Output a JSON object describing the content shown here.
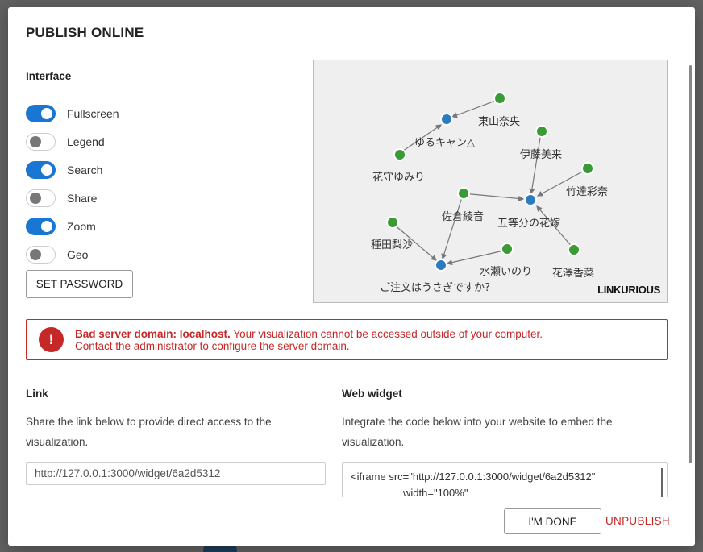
{
  "dialog": {
    "title": "PUBLISH ONLINE"
  },
  "interface": {
    "label": "Interface",
    "toggles": [
      {
        "label": "Fullscreen",
        "on": true
      },
      {
        "label": "Legend",
        "on": false
      },
      {
        "label": "Search",
        "on": true
      },
      {
        "label": "Share",
        "on": false
      },
      {
        "label": "Zoom",
        "on": true
      },
      {
        "label": "Geo",
        "on": false
      }
    ],
    "set_password_label": "SET PASSWORD"
  },
  "preview": {
    "brand": "LINKURIOUS",
    "colors": {
      "blue_node": "#2a7bc0",
      "green_node": "#3a9a35",
      "edge": "#777777"
    },
    "nodes": [
      {
        "id": "n1",
        "color": "blue",
        "label": "ゆるキャン△"
      },
      {
        "id": "n2",
        "color": "green",
        "label": "東山奈央"
      },
      {
        "id": "n3",
        "color": "green",
        "label": "花守ゆみり"
      },
      {
        "id": "n4",
        "color": "green",
        "label": "伊藤美来"
      },
      {
        "id": "n5",
        "color": "green",
        "label": "竹達彩奈"
      },
      {
        "id": "n6",
        "color": "blue",
        "label": "五等分の花嫁"
      },
      {
        "id": "n7",
        "color": "green",
        "label": "佐倉綾音"
      },
      {
        "id": "n8",
        "color": "green",
        "label": "種田梨沙"
      },
      {
        "id": "n9",
        "color": "green",
        "label": "花澤香菜"
      },
      {
        "id": "n10",
        "color": "green",
        "label": "水瀬いのり"
      },
      {
        "id": "n11",
        "color": "blue",
        "label": "ご注文はうさぎですか?"
      }
    ]
  },
  "alert": {
    "title": "Bad server domain: localhost.",
    "message": " Your visualization cannot be accessed outside of your computer.",
    "message2": "Contact the administrator to configure the server domain."
  },
  "link": {
    "label": "Link",
    "description": "Share the link below to provide direct access to the visualization.",
    "url": "http://127.0.0.1:3000/widget/6a2d5312"
  },
  "widget": {
    "label": "Web widget",
    "description": "Integrate the code below into your website to embed the visualization.",
    "code": "<iframe src=\"http://127.0.0.1:3000/widget/6a2d5312\"\n                  width=\"100%\""
  },
  "footer": {
    "done_label": "I'M DONE",
    "unpublish_label": "UNPUBLISH"
  }
}
